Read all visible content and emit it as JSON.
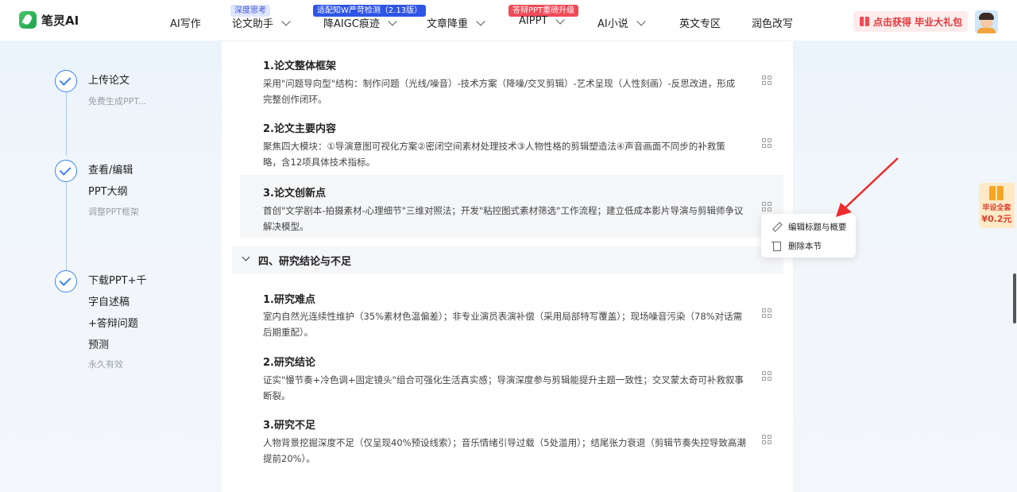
{
  "brand": {
    "name": "笔灵AI"
  },
  "nav": [
    {
      "label": "AI写作",
      "has_dropdown": false
    },
    {
      "label": "论文助手",
      "has_dropdown": true,
      "badge": "深度思考"
    },
    {
      "label": "降AIGC痕迹",
      "has_dropdown": true,
      "badge": "适配知W严苛检测（2.13版）"
    },
    {
      "label": "文章降重",
      "has_dropdown": true
    },
    {
      "label": "AIPPT",
      "has_dropdown": true,
      "badge": "答辩PPT重磅升级"
    },
    {
      "label": "AI小说",
      "has_dropdown": true
    },
    {
      "label": "英文专区",
      "has_dropdown": false
    },
    {
      "label": "润色改写",
      "has_dropdown": false
    }
  ],
  "gift": {
    "label": "点击获得 毕业大礼包"
  },
  "steps": [
    {
      "title": "上传论文",
      "sub": "免费生成PPT..."
    },
    {
      "title_lines": [
        "查看/编辑",
        "PPT大纲"
      ],
      "sub": "调整PPT框架"
    },
    {
      "title_lines": [
        "下载PPT+千",
        "字自述稿",
        "+答辩问题",
        "预测"
      ],
      "sub": "永久有效"
    }
  ],
  "sections": [
    {
      "title": "1.论文整体框架",
      "lines": [
        "采用\"问题导向型\"结构：制作问题（光线/噪音）-技术方案（降噪/交叉剪辑）-艺术呈现（人性刻画）-反思改进，形成",
        "完整创作闭环。"
      ]
    },
    {
      "title": "2.论文主要内容",
      "lines": [
        "聚焦四大模块：①导演意图可视化方案②密闭空间素材处理技术③人物性格的剪辑塑造法④声音画面不同步的补救策",
        "略，含12项具体技术指标。"
      ]
    },
    {
      "title": "3.论文创新点",
      "lines": [
        "首创\"文学剧本-拍摄素材-心理细节\"三维对照法；开发\"粘控图式素材筛选\"工作流程；建立低成本影片导演与剪辑师争议",
        "解决模型。"
      ]
    }
  ],
  "chapter": {
    "title": "四、研究结论与不足"
  },
  "sections2": [
    {
      "title": "1.研究难点",
      "lines": [
        "室内自然光连续性维护（35%素材色温偏差）；非专业演员表演补偿（采用局部特写覆盖）；现场噪音污染（78%对话需",
        "后期重配）。"
      ]
    },
    {
      "title": "2.研究结论",
      "lines": [
        "证实\"慢节奏+冷色调+固定镜头\"组合可强化生活真实感；导演深度参与剪辑能提升主题一致性；交叉蒙太奇可补救叙事",
        "断裂。"
      ]
    },
    {
      "title": "3.研究不足",
      "lines": [
        "人物背景挖掘深度不足（仅呈现40%预设线索）；音乐情绪引导过载（5处滥用）；结尾张力衰退（剪辑节奏失控导致高潮",
        "提前20%）。"
      ]
    }
  ],
  "context_menu": [
    {
      "label": "编辑标题与概要",
      "icon": "pencil-icon"
    },
    {
      "label": "删除本节",
      "icon": "trash-icon"
    }
  ],
  "promo": {
    "line1": "毕设全套",
    "line2": "¥0.2元"
  }
}
